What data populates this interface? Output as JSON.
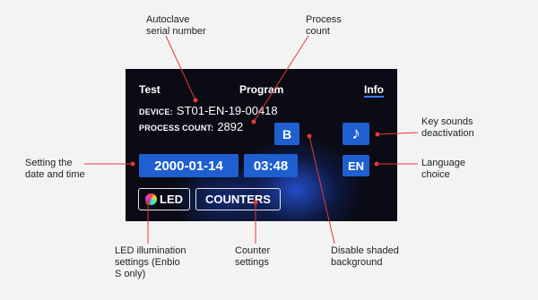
{
  "annotations": {
    "serial": "Autoclave\nserial number",
    "process_count": "Process\ncount",
    "key_sounds": "Key sounds\ndeactivation",
    "date_time": "Setting the\ndate and time",
    "language": "Language\nchoice",
    "led": "LED illumination\nsettings (Enbio\nS only)",
    "counters": "Counter\nsettings",
    "shaded_bg": "Disable shaded\nbackground"
  },
  "screen": {
    "tabs": [
      {
        "label": "Test"
      },
      {
        "label": "Program"
      },
      {
        "label": "Info",
        "active": true
      }
    ],
    "device_label": "DEVICE:",
    "device_value": "ST01-EN-19-00418",
    "count_label": "PROCESS COUNT:",
    "count_value": "2892",
    "shade_button": "B",
    "sound_button_icon": "music-note-icon",
    "sound_button_glyph": "♪",
    "date": "2000-01-14",
    "time": "03:48",
    "language": "EN",
    "led_label": "LED",
    "counters_label": "COUNTERS"
  },
  "colors": {
    "screen_bg": "#0a0b14",
    "button_blue": "#1f5fd0",
    "accent_underline": "#3a7bff",
    "callout_line": "#e53935"
  }
}
